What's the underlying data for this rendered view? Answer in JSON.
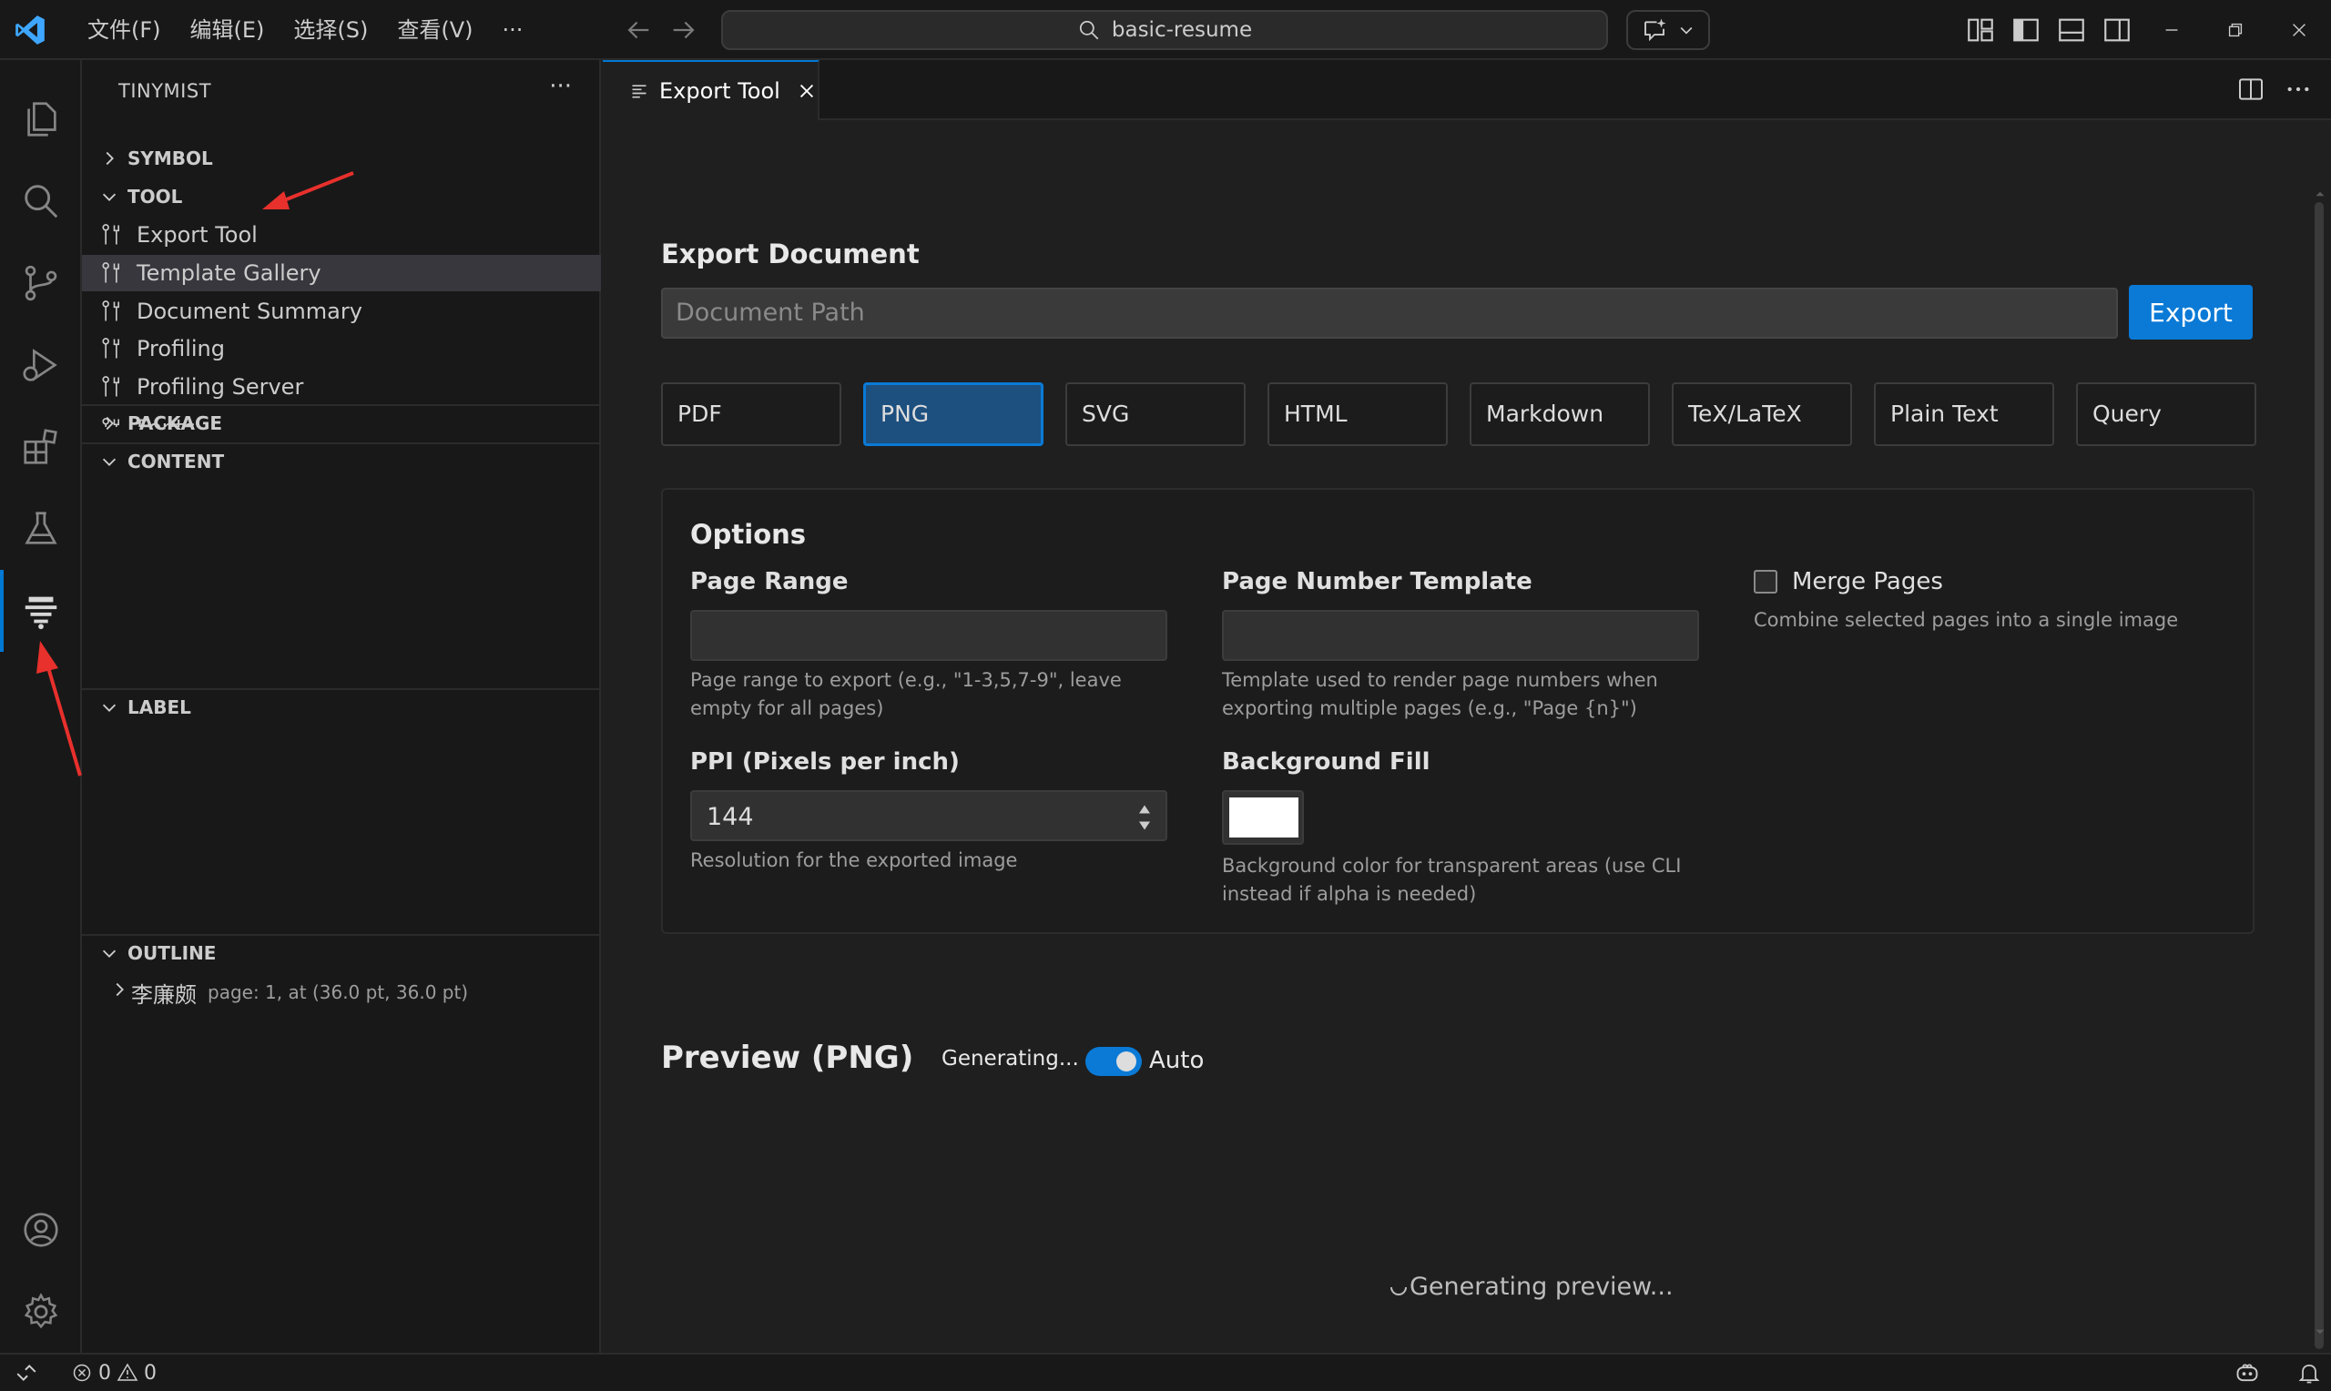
{
  "menu": [
    "文件(F)",
    "编辑(E)",
    "选择(S)",
    "查看(V)",
    "···"
  ],
  "search": {
    "text": "basic-resume"
  },
  "sidebar": {
    "title": "TINYMIST",
    "more": "···",
    "sections": {
      "symbol": "SYMBOL",
      "tool": "TOOL",
      "package": "PACKAGE",
      "content": "CONTENT",
      "label": "LABEL",
      "outline": "OUTLINE"
    },
    "tools": [
      {
        "label": "Export Tool"
      },
      {
        "label": "Template Gallery"
      },
      {
        "label": "Document Summary"
      },
      {
        "label": "Profiling"
      },
      {
        "label": "Profiling Server"
      },
      {
        "label": "Fonts"
      }
    ],
    "outline_item": {
      "label": "李廉颇",
      "desc": "page: 1, at (36.0 pt, 36.0 pt)"
    }
  },
  "tab": {
    "label": "Export Tool"
  },
  "export": {
    "heading": "Export Document",
    "path_placeholder": "Document Path",
    "button": "Export",
    "formats": [
      "PDF",
      "PNG",
      "SVG",
      "HTML",
      "Markdown",
      "TeX/LaTeX",
      "Plain Text",
      "Query"
    ],
    "selected_format": "PNG"
  },
  "options": {
    "title": "Options",
    "page_range": {
      "label": "Page Range",
      "help": "Page range to export (e.g., \"1-3,5,7-9\", leave empty for all pages)"
    },
    "page_number_template": {
      "label": "Page Number Template",
      "help": "Template used to render page numbers when exporting multiple pages (e.g., \"Page {n}\")"
    },
    "merge_pages": {
      "label": "Merge Pages",
      "help": "Combine selected pages into a single image",
      "checked": false
    },
    "ppi": {
      "label": "PPI (Pixels per inch)",
      "value": "144",
      "help": "Resolution for the exported image"
    },
    "background_fill": {
      "label": "Background Fill",
      "color": "#ffffff",
      "help": "Background color for transparent areas (use CLI instead if alpha is needed)"
    }
  },
  "preview": {
    "title": "Preview (PNG)",
    "status": "Generating...",
    "auto_label": "Auto",
    "auto_enabled": true,
    "generating_message": "Generating preview..."
  },
  "status_bar": {
    "errors": "0",
    "warnings": "0"
  },
  "colors": {
    "accent": "#0a7ad6",
    "annotation_arrow": "#e8302c"
  }
}
